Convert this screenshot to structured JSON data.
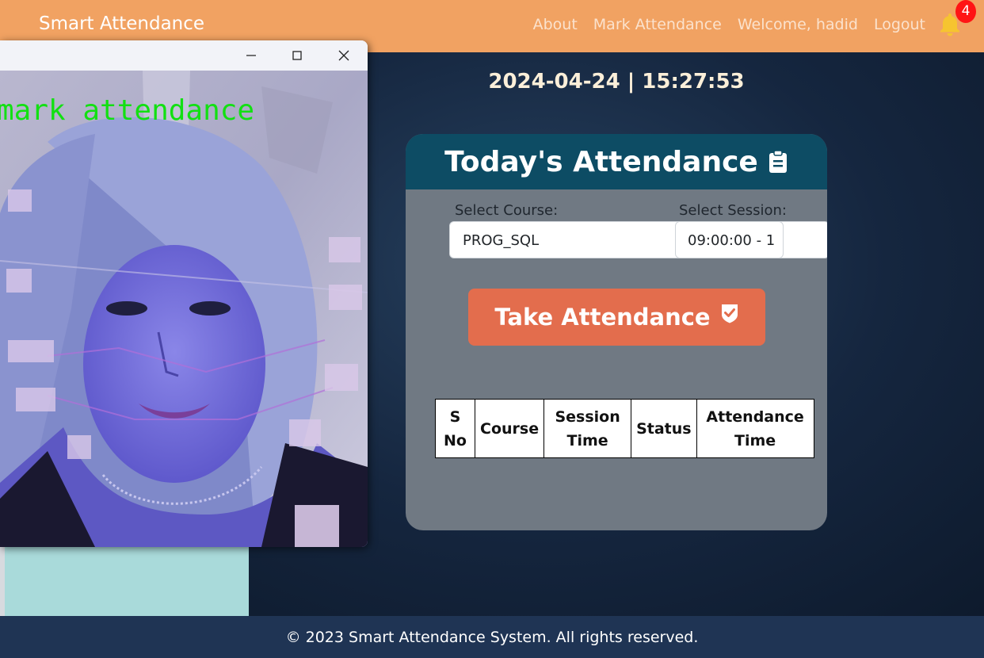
{
  "navbar": {
    "brand": "Smart Attendance",
    "links": [
      "About",
      "Mark Attendance",
      "Welcome, hadid",
      "Logout"
    ],
    "notification_count": "4"
  },
  "datetime": "2024-04-24 | 15:27:53",
  "card": {
    "title": "Today's Attendance",
    "course_label": "Select Course:",
    "course_value": "PROG_SQL",
    "session_label": "Select Session:",
    "session_value": "09:00:00 - 1",
    "take_button": "Take Attendance",
    "table_headers": [
      [
        "S",
        "No"
      ],
      [
        "Course"
      ],
      [
        "Session",
        "Time"
      ],
      [
        "Status"
      ],
      [
        "Attendance",
        "Time"
      ]
    ]
  },
  "camera": {
    "overlay_text": "mark attendance"
  },
  "footer": "© 2023 Smart Attendance System. All rights reserved.",
  "colors": {
    "navbar": "#f1a262",
    "card_header": "#0d4c64",
    "take_button": "#e36d4d",
    "footer": "#1f3454",
    "badge": "#ff1414"
  },
  "icons": [
    "bell-icon",
    "clipboard-icon",
    "check-badge-icon",
    "minimize-icon",
    "maximize-icon",
    "close-icon"
  ]
}
